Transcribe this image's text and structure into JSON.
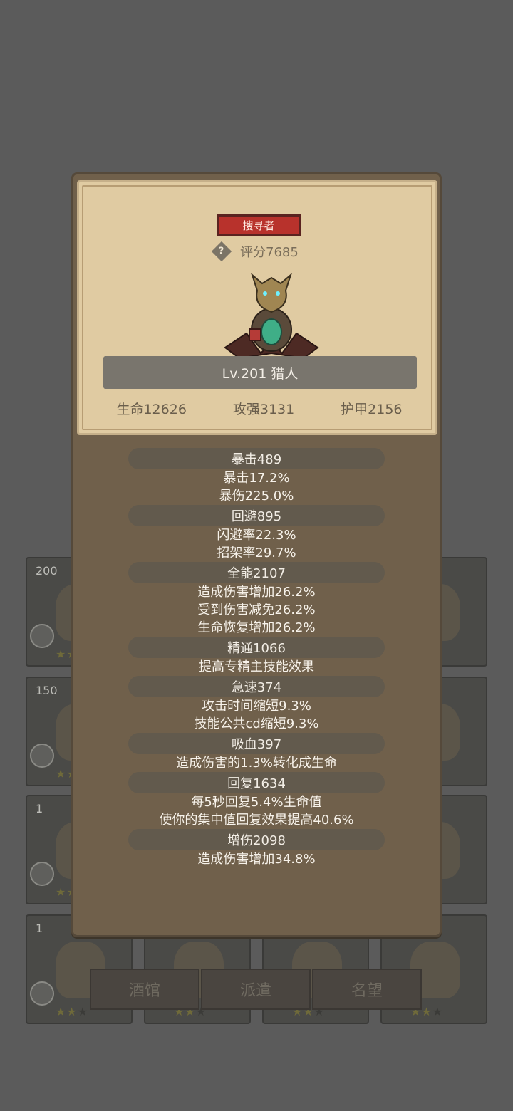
{
  "background": {
    "cards": [
      {
        "count": "200",
        "stars": 2
      },
      {
        "count": "",
        "stars": 2
      },
      {
        "count": "",
        "stars": 2
      },
      {
        "count": "",
        "stars": 2
      },
      {
        "count": "150",
        "stars": 2
      },
      {
        "count": "",
        "stars": 2
      },
      {
        "count": "",
        "stars": 2
      },
      {
        "count": "",
        "stars": 2
      },
      {
        "count": "1",
        "stars": 2
      },
      {
        "count": "",
        "stars": 2
      },
      {
        "count": "",
        "stars": 2
      },
      {
        "count": "",
        "stars": 2
      },
      {
        "count": "1",
        "stars": 2
      },
      {
        "count": "",
        "stars": 2
      },
      {
        "count": "",
        "stars": 2
      },
      {
        "count": "",
        "stars": 2
      }
    ],
    "tabs": [
      "酒馆",
      "派遣",
      "名望"
    ]
  },
  "hero": {
    "class_tag": "搜寻者",
    "help_icon": "?",
    "score": "评分7685",
    "name_level": "Lv.201 猎人",
    "stats": [
      "生命12626",
      "攻强3131",
      "护甲2156"
    ]
  },
  "attributes": [
    {
      "head": "暴击489",
      "lines": [
        "暴击17.2%",
        "暴伤225.0%"
      ]
    },
    {
      "head": "回避895",
      "lines": [
        "闪避率22.3%",
        "招架率29.7%"
      ]
    },
    {
      "head": "全能2107",
      "lines": [
        "造成伤害增加26.2%",
        "受到伤害减免26.2%",
        "生命恢复增加26.2%"
      ]
    },
    {
      "head": "精通1066",
      "lines": [
        "提高专精主技能效果"
      ]
    },
    {
      "head": "急速374",
      "lines": [
        "攻击时间缩短9.3%",
        "技能公共cd缩短9.3%"
      ]
    },
    {
      "head": "吸血397",
      "lines": [
        "造成伤害的1.3%转化成生命"
      ]
    },
    {
      "head": "回复1634",
      "lines": [
        "每5秒回复5.4%生命值",
        "使你的集中值回复效果提高40.6%"
      ]
    },
    {
      "head": "增伤2098",
      "lines": [
        "造成伤害增加34.8%"
      ]
    }
  ],
  "colors": {
    "overlay": "#5b5b5b",
    "panel": "#70604b",
    "parchment": "#e0cba2",
    "class_tag": "#b8322c"
  }
}
